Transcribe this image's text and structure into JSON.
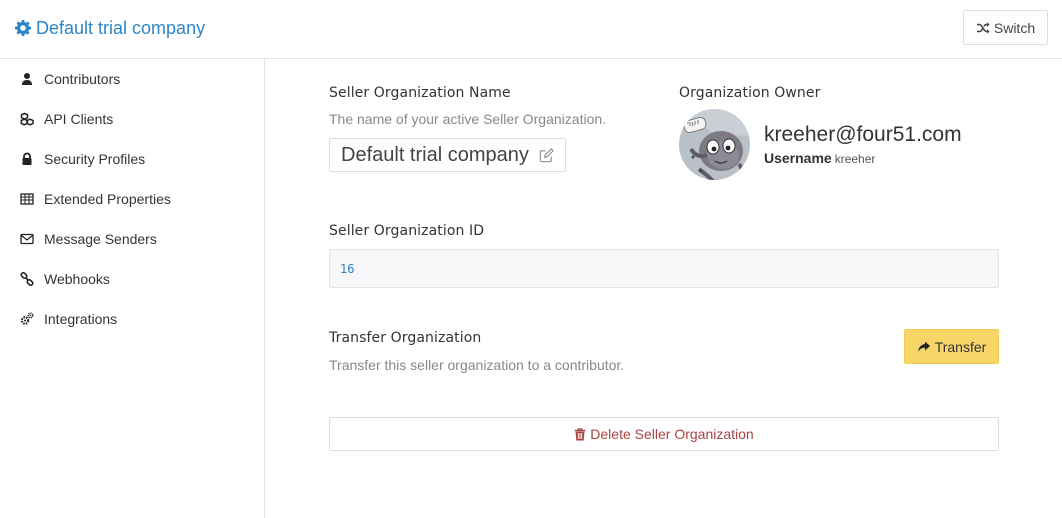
{
  "header": {
    "title": "Default trial company",
    "switch_label": "Switch"
  },
  "sidebar": {
    "items": [
      {
        "label": "Contributors",
        "icon": "user-icon"
      },
      {
        "label": "API Clients",
        "icon": "cubes-icon"
      },
      {
        "label": "Security Profiles",
        "icon": "lock-icon"
      },
      {
        "label": "Extended Properties",
        "icon": "table-icon"
      },
      {
        "label": "Message Senders",
        "icon": "envelope-icon"
      },
      {
        "label": "Webhooks",
        "icon": "link-icon"
      },
      {
        "label": "Integrations",
        "icon": "cogs-icon"
      }
    ]
  },
  "main": {
    "name_label": "Seller Organization Name",
    "name_help": "The name of your active Seller Organization.",
    "name_value": "Default trial company",
    "owner_label": "Organization Owner",
    "owner_email": "kreeher@four51.com",
    "owner_username_label": "Username",
    "owner_username_value": "kreeher",
    "id_label": "Seller Organization ID",
    "id_value": "16",
    "transfer_label": "Transfer Organization",
    "transfer_help": "Transfer this seller organization to a contributor.",
    "transfer_button": "Transfer",
    "delete_button": "Delete Seller Organization"
  },
  "colors": {
    "brand": "#2e86c9",
    "transfer_button_bg": "#f7d567",
    "danger_text": "#a94442",
    "id_text": "#2a7fc9"
  }
}
